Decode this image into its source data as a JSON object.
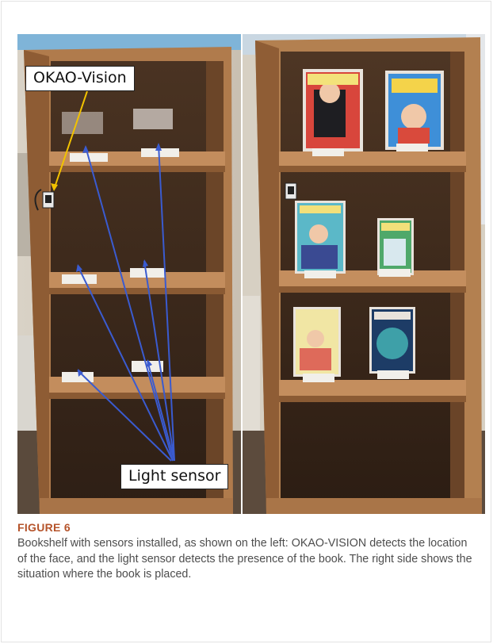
{
  "figure": {
    "label": "FIGURE 6",
    "caption": "Bookshelf with sensors installed, as shown on the left: OKAO-VISION detects the location of the face, and the light sensor detects the presence of the book. The right side shows the situation where the book is placed."
  },
  "left_photo": {
    "callouts": {
      "okao": "OKAO-Vision",
      "light": "Light sensor"
    },
    "arrow_colors": {
      "okao": "#f2c200",
      "light": "#3a5bd0"
    }
  },
  "right_photo": {}
}
